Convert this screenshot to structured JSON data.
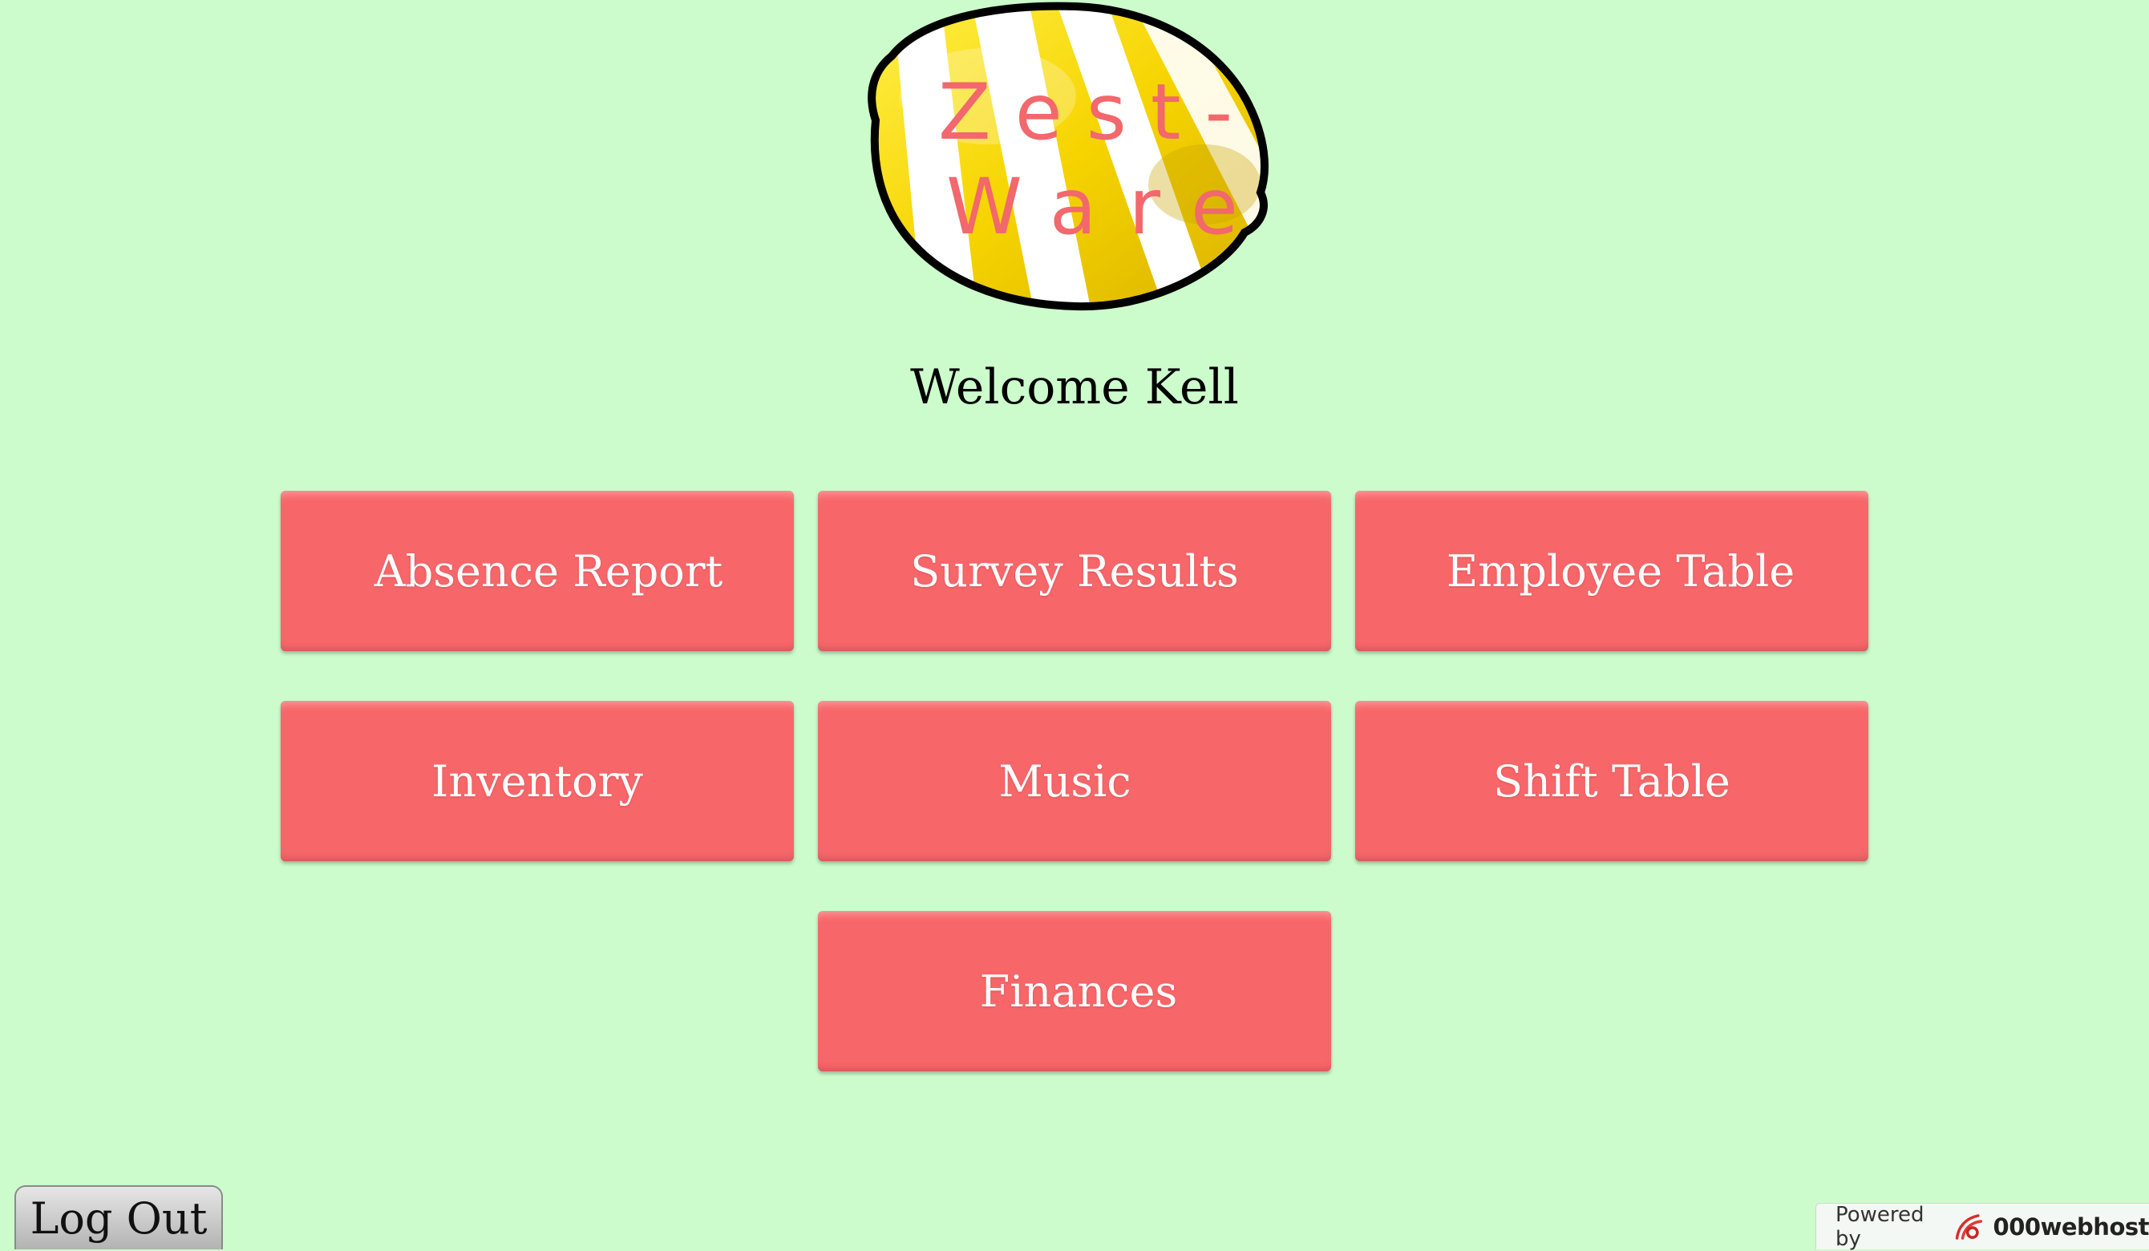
{
  "logo": {
    "line1": "Zest-",
    "line2": "Ware",
    "icon": "lemon-logo"
  },
  "welcome": "Welcome Kell",
  "menu": {
    "absence_report": "Absence Report",
    "survey_results": "Survey Results",
    "employee_table": "Employee Table",
    "inventory": "Inventory",
    "music": "Music",
    "shift_table": "Shift Table",
    "finances": "Finances"
  },
  "logout_label": "Log Out",
  "footer": {
    "powered_by": "Powered by",
    "brand": "000webhost",
    "icon": "000webhost-icon"
  },
  "colors": {
    "background": "#ccfccc",
    "button": "#f76669",
    "logo_text": "#f2686c",
    "lemon": "#f5d90a"
  }
}
